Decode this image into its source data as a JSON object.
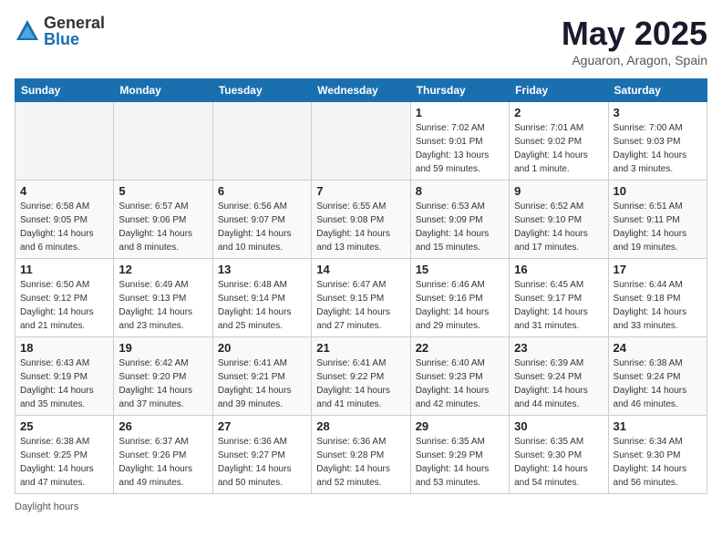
{
  "logo": {
    "general": "General",
    "blue": "Blue"
  },
  "title": "May 2025",
  "location": "Aguaron, Aragon, Spain",
  "days_of_week": [
    "Sunday",
    "Monday",
    "Tuesday",
    "Wednesday",
    "Thursday",
    "Friday",
    "Saturday"
  ],
  "footer": "Daylight hours",
  "weeks": [
    [
      {
        "day": "",
        "empty": true
      },
      {
        "day": "",
        "empty": true
      },
      {
        "day": "",
        "empty": true
      },
      {
        "day": "",
        "empty": true
      },
      {
        "day": "1",
        "sunrise": "7:02 AM",
        "sunset": "9:01 PM",
        "daylight": "13 hours and 59 minutes."
      },
      {
        "day": "2",
        "sunrise": "7:01 AM",
        "sunset": "9:02 PM",
        "daylight": "14 hours and 1 minute."
      },
      {
        "day": "3",
        "sunrise": "7:00 AM",
        "sunset": "9:03 PM",
        "daylight": "14 hours and 3 minutes."
      }
    ],
    [
      {
        "day": "4",
        "sunrise": "6:58 AM",
        "sunset": "9:05 PM",
        "daylight": "14 hours and 6 minutes."
      },
      {
        "day": "5",
        "sunrise": "6:57 AM",
        "sunset": "9:06 PM",
        "daylight": "14 hours and 8 minutes."
      },
      {
        "day": "6",
        "sunrise": "6:56 AM",
        "sunset": "9:07 PM",
        "daylight": "14 hours and 10 minutes."
      },
      {
        "day": "7",
        "sunrise": "6:55 AM",
        "sunset": "9:08 PM",
        "daylight": "14 hours and 13 minutes."
      },
      {
        "day": "8",
        "sunrise": "6:53 AM",
        "sunset": "9:09 PM",
        "daylight": "14 hours and 15 minutes."
      },
      {
        "day": "9",
        "sunrise": "6:52 AM",
        "sunset": "9:10 PM",
        "daylight": "14 hours and 17 minutes."
      },
      {
        "day": "10",
        "sunrise": "6:51 AM",
        "sunset": "9:11 PM",
        "daylight": "14 hours and 19 minutes."
      }
    ],
    [
      {
        "day": "11",
        "sunrise": "6:50 AM",
        "sunset": "9:12 PM",
        "daylight": "14 hours and 21 minutes."
      },
      {
        "day": "12",
        "sunrise": "6:49 AM",
        "sunset": "9:13 PM",
        "daylight": "14 hours and 23 minutes."
      },
      {
        "day": "13",
        "sunrise": "6:48 AM",
        "sunset": "9:14 PM",
        "daylight": "14 hours and 25 minutes."
      },
      {
        "day": "14",
        "sunrise": "6:47 AM",
        "sunset": "9:15 PM",
        "daylight": "14 hours and 27 minutes."
      },
      {
        "day": "15",
        "sunrise": "6:46 AM",
        "sunset": "9:16 PM",
        "daylight": "14 hours and 29 minutes."
      },
      {
        "day": "16",
        "sunrise": "6:45 AM",
        "sunset": "9:17 PM",
        "daylight": "14 hours and 31 minutes."
      },
      {
        "day": "17",
        "sunrise": "6:44 AM",
        "sunset": "9:18 PM",
        "daylight": "14 hours and 33 minutes."
      }
    ],
    [
      {
        "day": "18",
        "sunrise": "6:43 AM",
        "sunset": "9:19 PM",
        "daylight": "14 hours and 35 minutes."
      },
      {
        "day": "19",
        "sunrise": "6:42 AM",
        "sunset": "9:20 PM",
        "daylight": "14 hours and 37 minutes."
      },
      {
        "day": "20",
        "sunrise": "6:41 AM",
        "sunset": "9:21 PM",
        "daylight": "14 hours and 39 minutes."
      },
      {
        "day": "21",
        "sunrise": "6:41 AM",
        "sunset": "9:22 PM",
        "daylight": "14 hours and 41 minutes."
      },
      {
        "day": "22",
        "sunrise": "6:40 AM",
        "sunset": "9:23 PM",
        "daylight": "14 hours and 42 minutes."
      },
      {
        "day": "23",
        "sunrise": "6:39 AM",
        "sunset": "9:24 PM",
        "daylight": "14 hours and 44 minutes."
      },
      {
        "day": "24",
        "sunrise": "6:38 AM",
        "sunset": "9:24 PM",
        "daylight": "14 hours and 46 minutes."
      }
    ],
    [
      {
        "day": "25",
        "sunrise": "6:38 AM",
        "sunset": "9:25 PM",
        "daylight": "14 hours and 47 minutes."
      },
      {
        "day": "26",
        "sunrise": "6:37 AM",
        "sunset": "9:26 PM",
        "daylight": "14 hours and 49 minutes."
      },
      {
        "day": "27",
        "sunrise": "6:36 AM",
        "sunset": "9:27 PM",
        "daylight": "14 hours and 50 minutes."
      },
      {
        "day": "28",
        "sunrise": "6:36 AM",
        "sunset": "9:28 PM",
        "daylight": "14 hours and 52 minutes."
      },
      {
        "day": "29",
        "sunrise": "6:35 AM",
        "sunset": "9:29 PM",
        "daylight": "14 hours and 53 minutes."
      },
      {
        "day": "30",
        "sunrise": "6:35 AM",
        "sunset": "9:30 PM",
        "daylight": "14 hours and 54 minutes."
      },
      {
        "day": "31",
        "sunrise": "6:34 AM",
        "sunset": "9:30 PM",
        "daylight": "14 hours and 56 minutes."
      }
    ]
  ]
}
